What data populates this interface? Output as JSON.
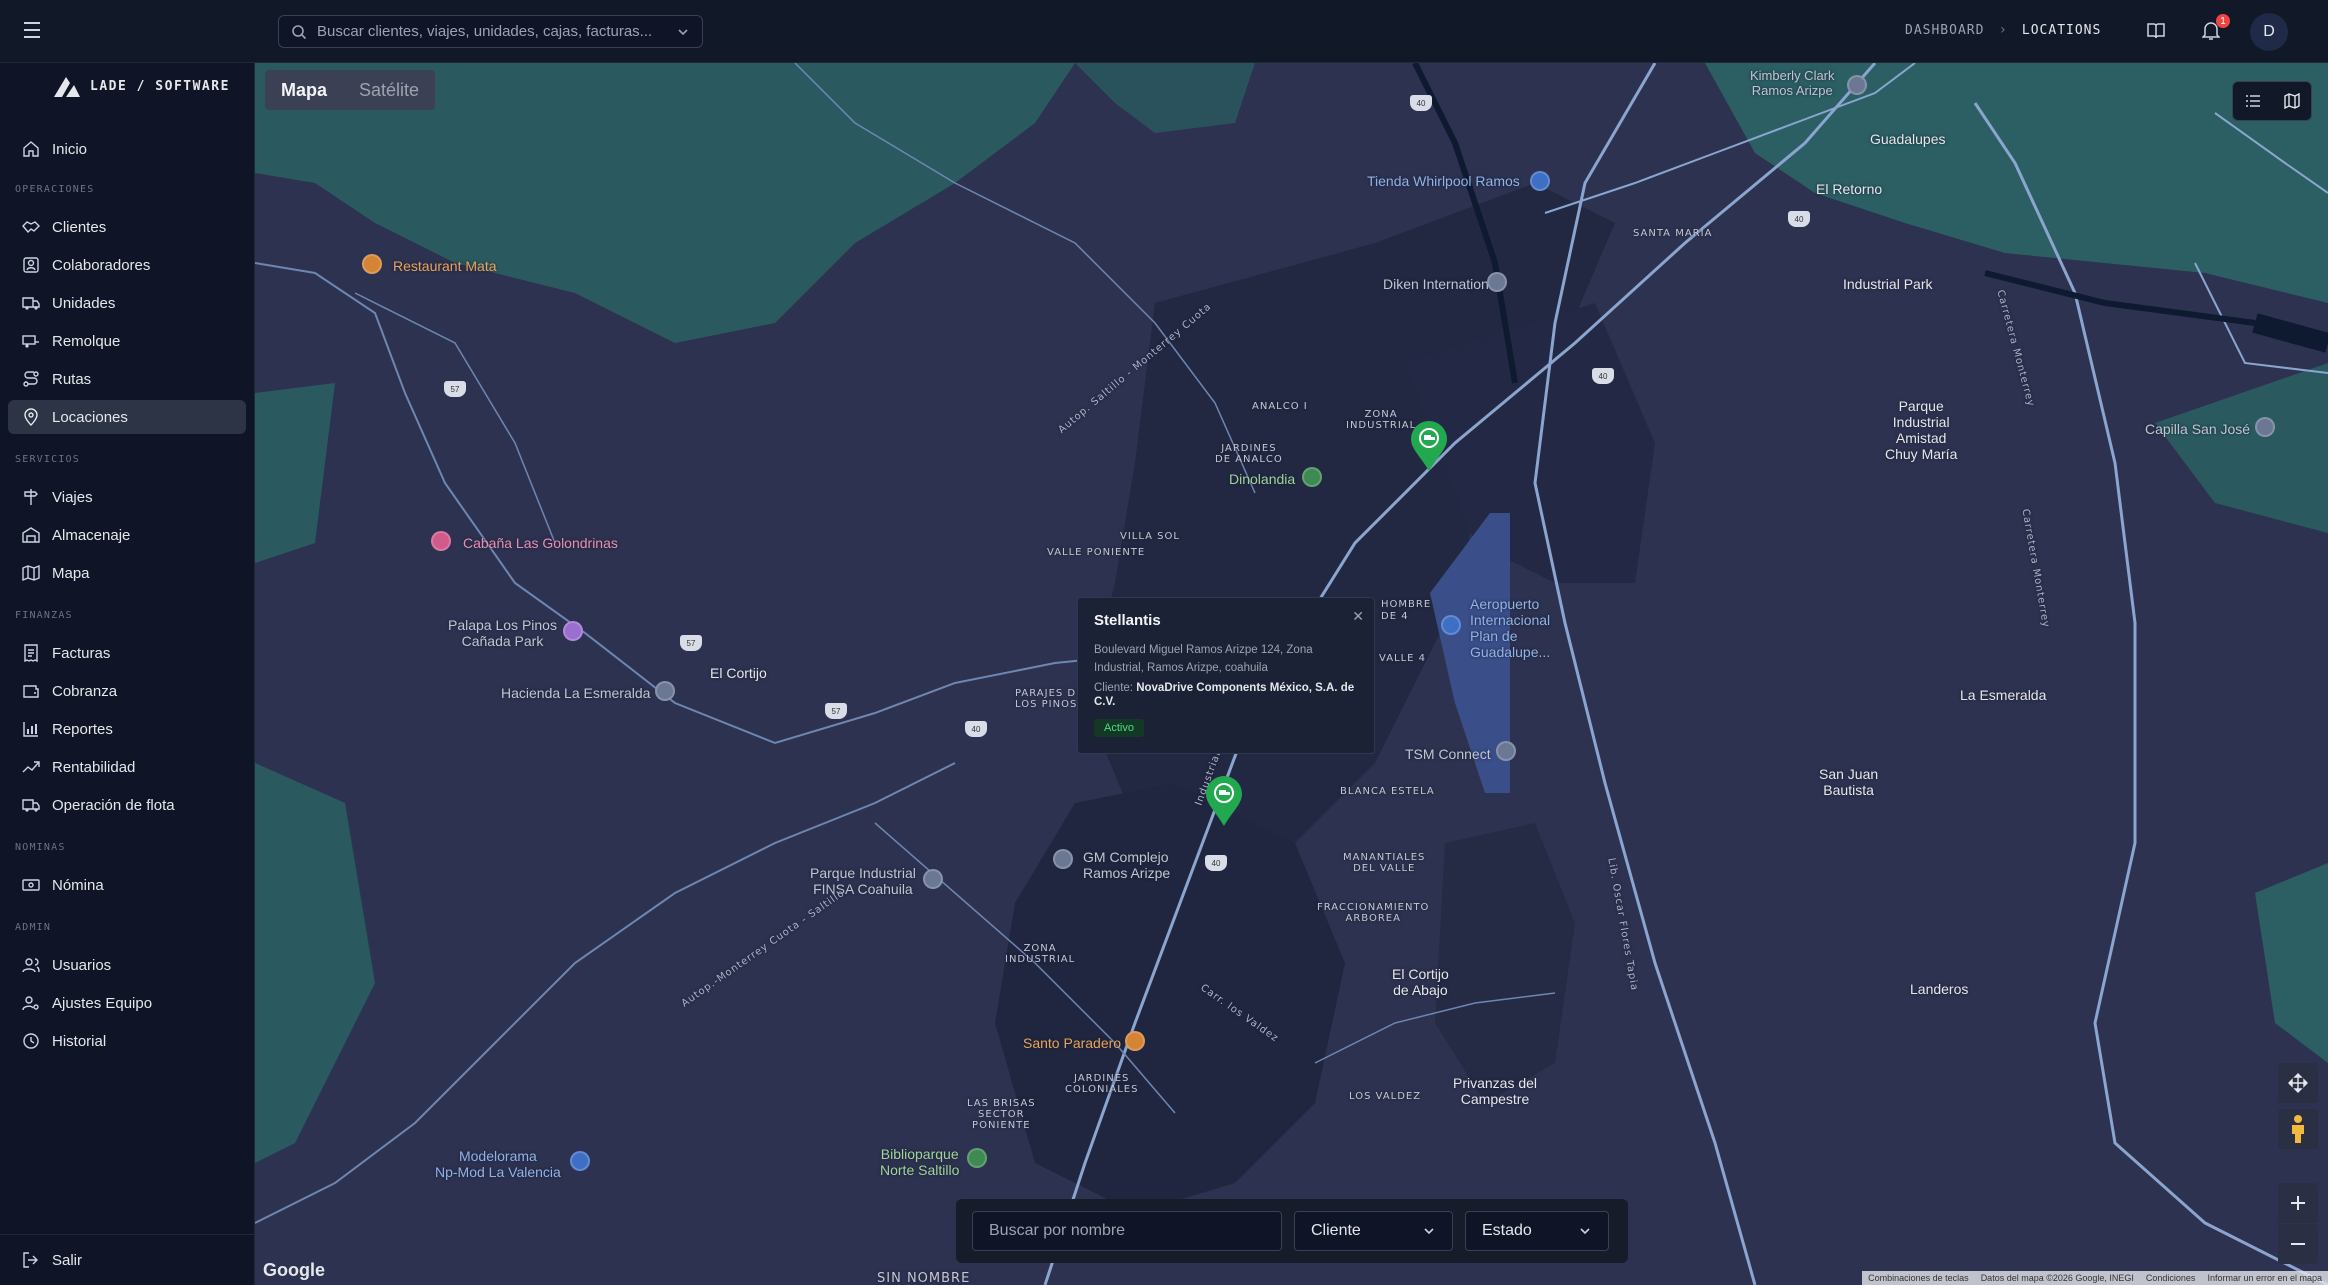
{
  "topbar": {
    "search_placeholder": "Buscar clientes, viajes, unidades, cajas, facturas...",
    "breadcrumb": [
      "DASHBOARD",
      "LOCATIONS"
    ],
    "notification_count": "1",
    "avatar_initial": "D"
  },
  "logo": {
    "text": "LADE / SOFTWARE"
  },
  "sidebar": {
    "home": "Inicio",
    "sections": {
      "operaciones": "OPERACIONES",
      "servicios": "SERVICIOS",
      "finanzas": "FINANZAS",
      "nominas": "NOMINAS",
      "admin": "ADMIN"
    },
    "operaciones": [
      "Clientes",
      "Colaboradores",
      "Unidades",
      "Remolque",
      "Rutas",
      "Locaciones"
    ],
    "servicios": [
      "Viajes",
      "Almacenaje",
      "Mapa"
    ],
    "finanzas": [
      "Facturas",
      "Cobranza",
      "Reportes",
      "Rentabilidad",
      "Operación de flota"
    ],
    "nominas": [
      "Nómina"
    ],
    "admin": [
      "Usuarios",
      "Ajustes Equipo",
      "Historial"
    ],
    "logout": "Salir",
    "active_item": "Locaciones"
  },
  "map": {
    "type_options": [
      "Mapa",
      "Satélite"
    ],
    "selected_type": "Mapa",
    "labels": {
      "kimberly": "Kimberly Clark\nRamos Arizpe",
      "guadalupes": "Guadalupes",
      "el_retorno": "El Retorno",
      "santa_maria": "SANTA MARÍA",
      "industrial_park": "Industrial Park",
      "tienda_whirlpool": "Tienda Whirlpool Ramos",
      "diken": "Diken International",
      "restaurant_mata": "Restaurant Mata",
      "analco": "ANALCO I",
      "zona_industrial_1": "ZONA\nINDUSTRIAL",
      "jardines_analco": "JARDINES\nDE ANALCO",
      "dinolandia": "Dinolandia",
      "parque_amistad": "Parque\nIndustrial\nAmistad\nChuy María",
      "capilla": "Capilla San José",
      "villa_sol": "VILLA SOL",
      "valle_poniente": "VALLE PONIENTE",
      "cabana": "Cabaña Las Golondrinas",
      "aeropuerto": "Aeropuerto\nInternacional\nPlan de\nGuadalupe...",
      "palapa": "Palapa Los Pinos\nCañada Park",
      "hacienda": "Hacienda La Esmeralda",
      "el_cortijo": "El Cortijo",
      "parajes": "PARAJES DE\nLOS PINOS",
      "la_esmeralda": "La Esmeralda",
      "tsm": "TSM Connect",
      "blanca_estela": "BLANCA ESTELA",
      "san_juan": "San Juan\nBautista",
      "gm": "GM Complejo\nRamos Arizpe",
      "parque_finsa": "Parque Industrial\nFINSA Coahuila",
      "manantiales": "MANANTIALES\nDEL VALLE",
      "fraccionamiento": "FRACCIONAMIENTO\nARBOREA",
      "zona_industrial_2": "ZONA\nINDUSTRIAL",
      "el_cortijo_abajo": "El Cortijo\nde Abajo",
      "landeros": "Landeros",
      "santo_paradero": "Santo Paradero",
      "jardines_coloniales": "JARDINES\nCOLONIALES",
      "las_brisas": "LAS BRISAS\nSECTOR\nPONIENTE",
      "los_valdez": "LOS VALDEZ",
      "privanzas": "Privanzas del\nCampestre",
      "modelorama": "Modelorama\nNp-Mod La Valencia",
      "biblioparque": "Biblioparque\nNorte Saltillo",
      "sin_nombre": "SIN NOMBRE",
      "road_1": "Autop. Saltillo - Monterrey Cuota",
      "road_2": "Autop.-Monterrey Cuota - Saltillo",
      "road_3": "Lib. Oscar Flores Tapia",
      "road_4": "Industrial",
      "road_5": "Carr. los Valdez",
      "road_6": "Carretera Monterrey",
      "road_7": "Carretera Monterrey",
      "hombre_1": "HOMBRE",
      "hombre_2": "DE 4",
      "valle_4": "VALLE 4"
    },
    "shields": [
      "57",
      "57",
      "57",
      "40",
      "40",
      "40",
      "40",
      "40"
    ],
    "popup": {
      "title": "Stellantis",
      "address": "Boulevard Miguel Ramos Arizpe 124, Zona Industrial, Ramos Arizpe, coahuila",
      "client_label": "Cliente:",
      "client_name": "NovaDrive Components México, S.A. de C.V.",
      "status": "Activo"
    },
    "filters": {
      "name_placeholder": "Buscar por nombre",
      "client_label": "Cliente",
      "status_label": "Estado"
    },
    "google_logo": "Google",
    "attribution": [
      "Combinaciones de teclas",
      "Datos del mapa ©2026 Google, INEGI",
      "Condiciones",
      "Informar un error en el mapa"
    ]
  }
}
